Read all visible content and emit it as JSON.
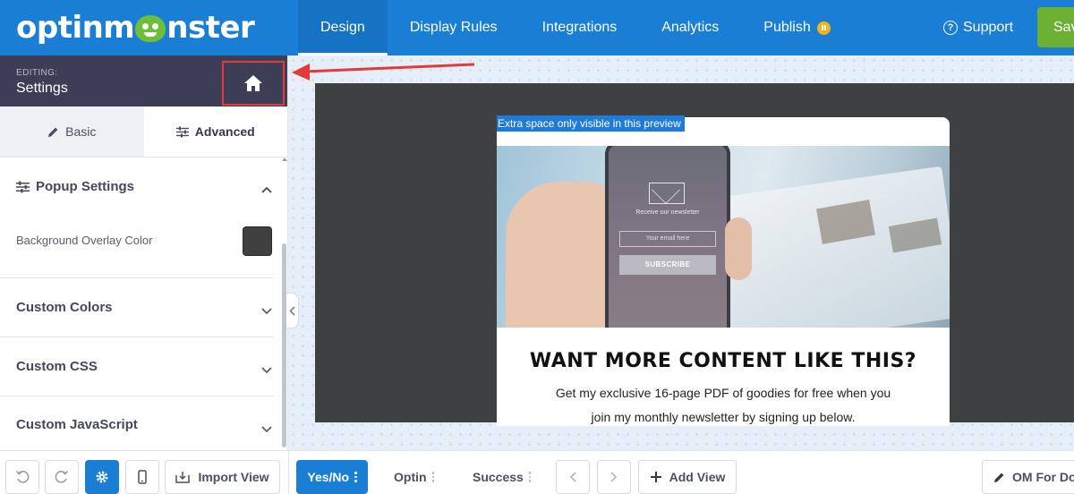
{
  "header": {
    "logo_text_left": "optinm",
    "logo_text_right": "nster",
    "nav": [
      {
        "label": "Design",
        "active": true
      },
      {
        "label": "Display Rules",
        "active": false
      },
      {
        "label": "Integrations",
        "active": false
      },
      {
        "label": "Analytics",
        "active": false
      },
      {
        "label": "Publish",
        "active": false,
        "badge": "pause-icon"
      }
    ],
    "support_label": "Support",
    "save_label": "Save"
  },
  "sidebar": {
    "editing_label": "EDITING:",
    "editing_title": "Settings",
    "home_icon": "home-icon",
    "tabs": [
      {
        "label": "Basic",
        "icon": "pencil-icon"
      },
      {
        "label": "Advanced",
        "icon": "sliders-icon"
      }
    ],
    "sections": [
      {
        "title": "Popup Settings",
        "expanded": true
      },
      {
        "title": "Custom Colors",
        "expanded": false
      },
      {
        "title": "Custom CSS",
        "expanded": false
      },
      {
        "title": "Custom JavaScript",
        "expanded": false
      }
    ],
    "overlay_color_label": "Background Overlay Color",
    "overlay_color": "#404040"
  },
  "canvas": {
    "preview_tag": "Extra space only visible in this preview",
    "phone": {
      "caption": "Receive our newsletter",
      "input_placeholder": "Your email here",
      "button": "SUBSCRIBE"
    },
    "headline": "WANT MORE CONTENT LIKE THIS?",
    "body_line_1": "Get my exclusive 16-page PDF of goodies for free when you",
    "body_line_2": "join my monthly newsletter by signing up below."
  },
  "bottombar": {
    "import_view_label": "Import View",
    "views": [
      {
        "label": "Yes/No",
        "active": true
      },
      {
        "label": "Optin",
        "active": false
      },
      {
        "label": "Success",
        "active": false
      }
    ],
    "add_view_label": "Add View",
    "campaign_name": "OM For Do"
  },
  "colors": {
    "brand_blue": "#1a7fd4",
    "save_green": "#6cb033",
    "editing_header": "#3d3e55",
    "highlight_red": "#e23b3b"
  }
}
